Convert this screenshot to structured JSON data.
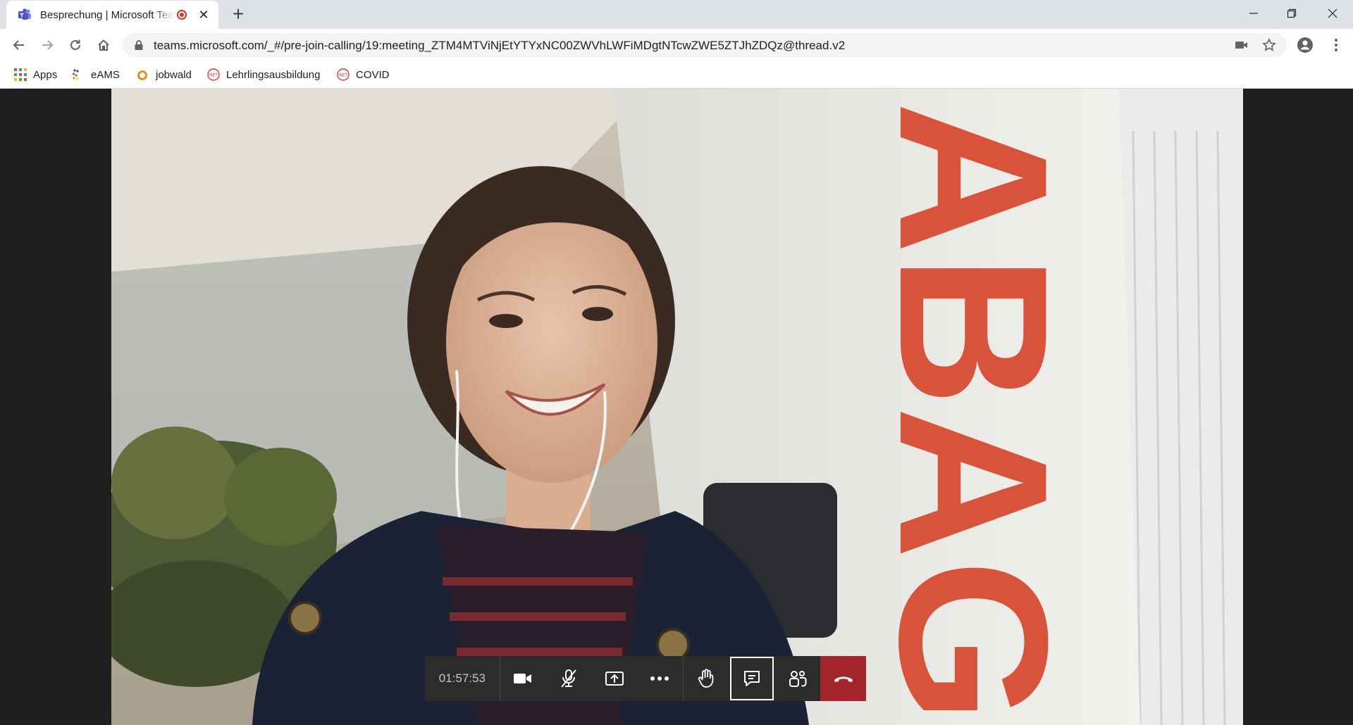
{
  "browser": {
    "tab": {
      "title": "Besprechung | Microsoft Teams",
      "close_glyph": "✕"
    },
    "new_tab_glyph": "+",
    "url": "teams.microsoft.com/_#/pre-join-calling/19:meeting_ZTM4MTViNjEtYTYxNC00ZWVhLWFiMDgtNTcwZWE5ZTJhZDQz@thread.v2",
    "bookmarks": [
      {
        "label": "Apps",
        "icon": "apps-grid-icon"
      },
      {
        "label": "eAMS",
        "icon": "eams-icon"
      },
      {
        "label": "jobwald",
        "icon": "jobwald-icon"
      },
      {
        "label": "Lehrlingsausbildung",
        "icon": "net-icon"
      },
      {
        "label": "COVID",
        "icon": "net-icon"
      }
    ],
    "colors": {
      "tabstrip": "#dee1e6",
      "omnibox": "#f1f3f4",
      "record": "#d93025"
    }
  },
  "video": {
    "banner_text": "ABAG",
    "colors": {
      "banner_letters": "#d9533a",
      "jacket": "#1b2236"
    }
  },
  "call_controls": {
    "timer": "01:57:53",
    "buttons": [
      {
        "name": "camera",
        "icon": "video-camera-icon"
      },
      {
        "name": "microphone-muted",
        "icon": "mic-off-icon"
      },
      {
        "name": "share-screen",
        "icon": "share-tray-icon"
      },
      {
        "name": "more-actions",
        "icon": "more-dots-icon"
      },
      {
        "name": "raise-hand",
        "icon": "hand-icon"
      },
      {
        "name": "chat",
        "icon": "chat-icon",
        "active": true
      },
      {
        "name": "participants",
        "icon": "people-icon"
      },
      {
        "name": "hang-up",
        "icon": "phone-hangup-icon"
      }
    ],
    "colors": {
      "bar": "#2d2c2c",
      "hangup": "#a4262c"
    }
  }
}
